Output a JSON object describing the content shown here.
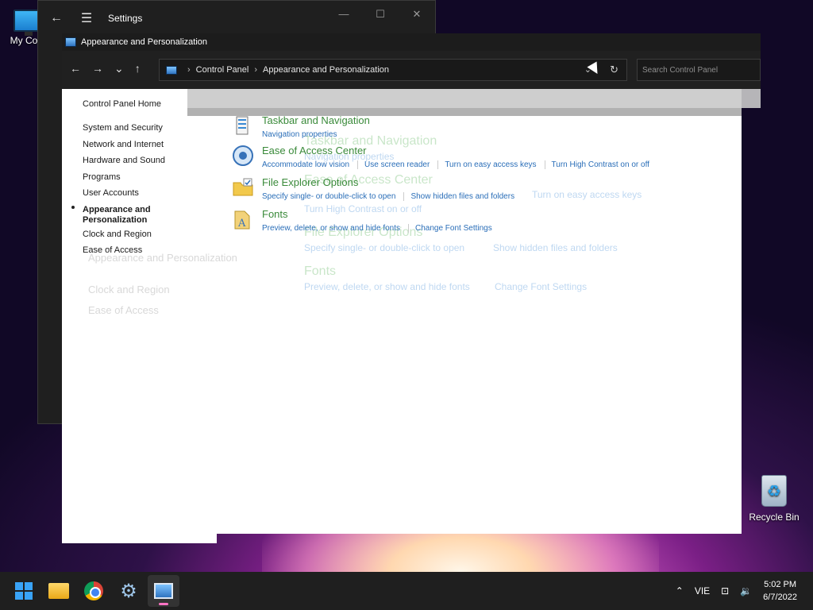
{
  "desktop": {
    "my_computer_label": "My Com",
    "recycle_bin_label": "Recycle Bin"
  },
  "settings_window": {
    "title": "Settings",
    "back_glyph": "←",
    "menu_glyph": "☰",
    "minimize_glyph": "—",
    "maximize_glyph": "☐",
    "close_glyph": "✕"
  },
  "control_panel": {
    "title": "Appearance and Personalization",
    "address": {
      "root": "Control Panel",
      "current": "Appearance and Personalization",
      "separator": "›"
    },
    "search_placeholder": "Search Control Panel",
    "nav": {
      "back": "←",
      "forward": "→",
      "recent": "⌄",
      "up": "↑",
      "refresh": "↻",
      "dropdown": "⌄"
    },
    "sidebar": {
      "home": "Control Panel Home",
      "items": [
        "System and Security",
        "Network and Internet",
        "Hardware and Sound",
        "Programs",
        "User Accounts",
        "Appearance and Personalization",
        "Clock and Region",
        "Ease of Access"
      ]
    },
    "categories": [
      {
        "title": "Taskbar and Navigation",
        "links": [
          "Navigation properties"
        ]
      },
      {
        "title": "Ease of Access Center",
        "links": [
          "Accommodate low vision",
          "Use screen reader",
          "Turn on easy access keys",
          "Turn High Contrast on or off"
        ]
      },
      {
        "title": "File Explorer Options",
        "links": [
          "Specify single- or double-click to open",
          "Show hidden files and folders"
        ]
      },
      {
        "title": "Fonts",
        "links": [
          "Preview, delete, or show and hide fonts",
          "Change Font Settings"
        ]
      }
    ]
  },
  "taskbar": {
    "language": "VIE",
    "time": "5:02 PM",
    "date": "6/7/2022",
    "chevron": "⌃",
    "network_glyph": "⊡",
    "volume_glyph": "🔉"
  }
}
